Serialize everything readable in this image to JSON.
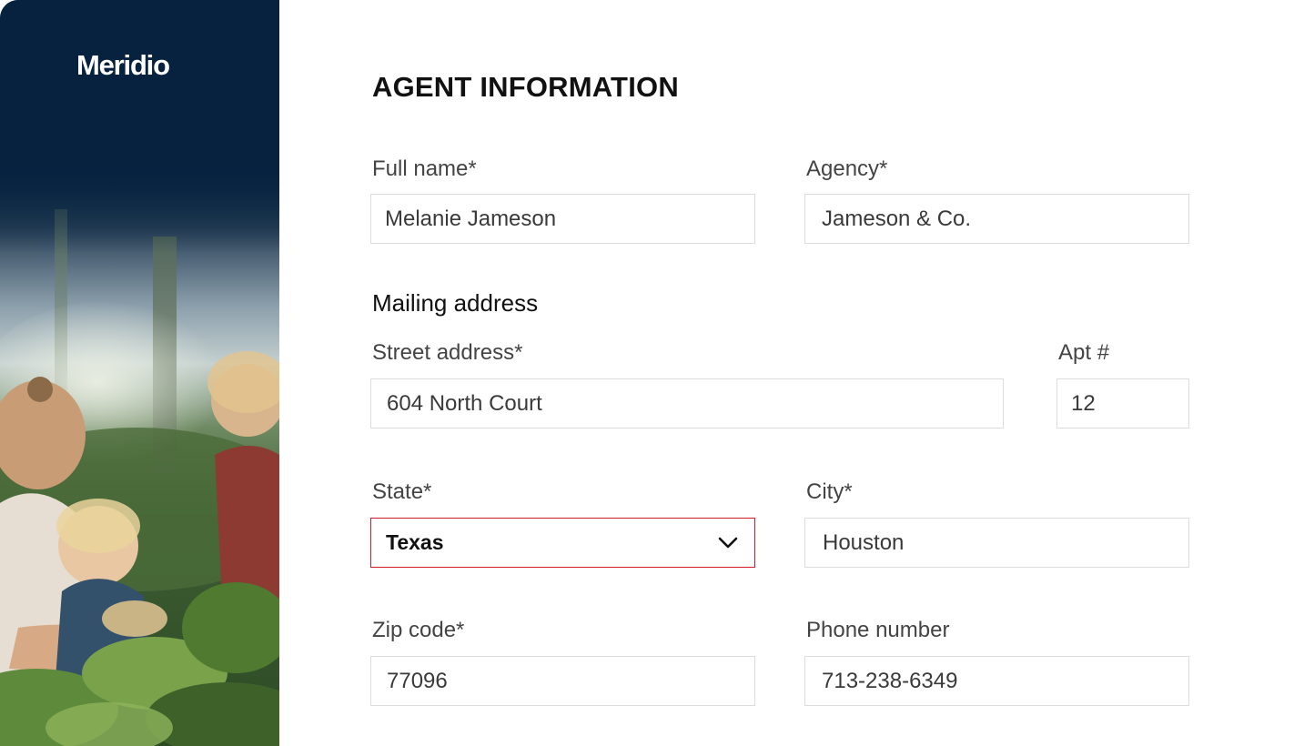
{
  "brand": {
    "logo": "Meridio"
  },
  "form": {
    "title": "AGENT INFORMATION",
    "mailing_heading": "Mailing address",
    "fields": {
      "full_name": {
        "label": "Full name*",
        "value": "Melanie Jameson"
      },
      "agency": {
        "label": "Agency*",
        "value": "Jameson & Co."
      },
      "street": {
        "label": "Street address*",
        "value": "604 North Court"
      },
      "apt": {
        "label": "Apt #",
        "value": "12"
      },
      "state": {
        "label": "State*",
        "value": "Texas"
      },
      "city": {
        "label": "City*",
        "value": "Houston"
      },
      "zip": {
        "label": "Zip code*",
        "value": "77096"
      },
      "phone": {
        "label": "Phone number",
        "value": "713-238-6349"
      }
    }
  },
  "colors": {
    "panel_navy": "#06223f",
    "error_border": "#d11a2a",
    "field_border": "#dcdcdc",
    "label_text": "#444444"
  },
  "icons": {
    "state_dropdown": "chevron-down-icon"
  }
}
